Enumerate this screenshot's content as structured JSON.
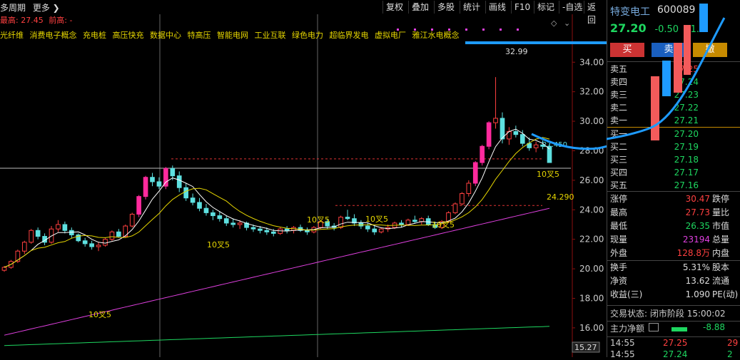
{
  "topbar": {
    "left_items": [
      "多周期",
      "更多 ❯"
    ],
    "buttons": [
      "复权",
      "叠加",
      "多股",
      "统计",
      "画线",
      "F10",
      "标记",
      "-自选",
      "返回"
    ]
  },
  "info": {
    "label1": "最高:",
    "value1": "27.45",
    "label2": "前高:",
    "value2": "-"
  },
  "concepts": [
    "光纤维",
    "消费电子概念",
    "充电桩",
    "高压快充",
    "数据中心",
    "特高压",
    "智能电网",
    "工业互联",
    "绿色电力",
    "超临界发电",
    "虚拟电厂",
    "雅江水电概念"
  ],
  "chart_data": {
    "type": "candlestick",
    "ylim": [
      15.27,
      35.8
    ],
    "yticks": [
      16.0,
      18.0,
      20.0,
      22.0,
      24.0,
      26.0,
      28.0,
      30.0,
      32.0,
      34.0
    ],
    "current_axis_label": "15.27",
    "candles": [
      [
        19.9,
        20.2,
        19.8,
        20.1
      ],
      [
        20.1,
        20.6,
        20.0,
        20.5
      ],
      [
        20.5,
        21.3,
        20.4,
        21.2
      ],
      [
        21.2,
        21.9,
        21.0,
        21.8
      ],
      [
        21.8,
        22.7,
        21.7,
        22.6
      ],
      [
        22.6,
        22.8,
        22.0,
        22.2
      ],
      [
        22.2,
        22.4,
        21.6,
        21.8
      ],
      [
        21.8,
        22.9,
        21.7,
        22.7
      ],
      [
        22.7,
        23.3,
        22.5,
        23.0
      ],
      [
        23.0,
        23.2,
        22.4,
        22.6
      ],
      [
        22.6,
        22.8,
        22.1,
        22.3
      ],
      [
        22.3,
        22.4,
        21.8,
        21.9
      ],
      [
        21.9,
        22.1,
        21.5,
        21.7
      ],
      [
        21.7,
        21.9,
        21.3,
        21.5
      ],
      [
        21.5,
        21.8,
        21.2,
        21.6
      ],
      [
        21.6,
        22.1,
        21.5,
        22.0
      ],
      [
        22.0,
        22.6,
        21.9,
        22.5
      ],
      [
        22.5,
        22.7,
        22.1,
        22.2
      ],
      [
        22.2,
        23.0,
        22.1,
        22.9
      ],
      [
        22.9,
        23.8,
        22.8,
        23.7
      ],
      [
        23.7,
        25.0,
        23.5,
        24.9
      ],
      [
        24.9,
        26.3,
        24.7,
        26.2
      ],
      [
        26.2,
        26.5,
        25.6,
        25.9
      ],
      [
        25.9,
        26.2,
        25.4,
        25.6
      ],
      [
        25.6,
        26.9,
        25.4,
        26.8
      ],
      [
        26.8,
        27.0,
        26.0,
        26.3
      ],
      [
        26.3,
        26.6,
        25.2,
        25.5
      ],
      [
        25.5,
        25.8,
        24.6,
        24.8
      ],
      [
        24.8,
        25.1,
        24.3,
        24.5
      ],
      [
        24.5,
        24.8,
        23.9,
        24.1
      ],
      [
        24.1,
        24.4,
        23.6,
        23.8
      ],
      [
        23.8,
        24.0,
        23.3,
        23.6
      ],
      [
        23.6,
        23.9,
        23.2,
        23.4
      ],
      [
        23.4,
        23.6,
        22.9,
        23.1
      ],
      [
        23.1,
        23.4,
        22.8,
        23.0
      ],
      [
        23.0,
        23.3,
        22.7,
        23.1
      ],
      [
        23.1,
        23.2,
        22.6,
        22.8
      ],
      [
        22.8,
        23.0,
        22.5,
        22.7
      ],
      [
        22.7,
        22.9,
        22.4,
        22.6
      ],
      [
        22.6,
        22.8,
        22.3,
        22.5
      ],
      [
        22.5,
        22.7,
        22.2,
        22.4
      ],
      [
        22.4,
        22.8,
        22.3,
        22.7
      ],
      [
        22.7,
        22.9,
        22.4,
        22.6
      ],
      [
        22.6,
        22.9,
        22.4,
        22.8
      ],
      [
        22.8,
        23.0,
        22.5,
        22.6
      ],
      [
        22.6,
        22.8,
        22.3,
        22.5
      ],
      [
        22.5,
        22.9,
        22.4,
        22.8
      ],
      [
        22.8,
        23.3,
        22.7,
        23.2
      ],
      [
        23.2,
        23.4,
        22.7,
        22.9
      ],
      [
        22.9,
        23.1,
        22.6,
        22.8
      ],
      [
        22.8,
        23.6,
        22.7,
        23.5
      ],
      [
        23.5,
        24.0,
        23.3,
        23.4
      ],
      [
        23.4,
        23.7,
        22.9,
        23.1
      ],
      [
        23.1,
        23.3,
        22.7,
        22.9
      ],
      [
        22.9,
        23.1,
        22.5,
        22.7
      ],
      [
        22.7,
        22.9,
        22.3,
        22.5
      ],
      [
        22.5,
        22.8,
        22.4,
        22.7
      ],
      [
        22.7,
        23.0,
        22.5,
        22.8
      ],
      [
        22.8,
        23.2,
        22.7,
        23.1
      ],
      [
        23.1,
        23.3,
        22.8,
        23.0
      ],
      [
        23.0,
        23.4,
        22.9,
        23.3
      ],
      [
        23.3,
        23.6,
        23.1,
        23.2
      ],
      [
        23.2,
        23.5,
        23.0,
        23.4
      ],
      [
        23.4,
        23.6,
        22.9,
        23.0
      ],
      [
        23.0,
        23.2,
        22.7,
        22.8
      ],
      [
        22.8,
        23.3,
        22.7,
        23.2
      ],
      [
        23.2,
        23.9,
        23.1,
        23.8
      ],
      [
        23.8,
        24.5,
        23.7,
        24.4
      ],
      [
        24.4,
        25.2,
        24.3,
        25.1
      ],
      [
        25.1,
        26.0,
        24.9,
        25.8
      ],
      [
        25.8,
        27.3,
        25.6,
        27.2
      ],
      [
        27.2,
        28.4,
        27.0,
        28.3
      ],
      [
        28.3,
        30.0,
        28.1,
        29.9
      ],
      [
        29.9,
        32.99,
        29.5,
        30.2
      ],
      [
        30.2,
        30.6,
        28.5,
        28.8
      ],
      [
        28.8,
        29.6,
        28.4,
        29.3
      ],
      [
        29.3,
        29.7,
        28.9,
        29.1
      ],
      [
        29.1,
        29.4,
        28.3,
        28.5
      ],
      [
        28.5,
        28.9,
        28.0,
        28.2
      ],
      [
        28.2,
        28.6,
        27.9,
        28.4
      ],
      [
        28.4,
        28.7,
        28.1,
        28.3
      ],
      [
        28.3,
        28.5,
        27.2,
        27.2
      ]
    ],
    "ma_labels": [
      "10叉5",
      "10叉5",
      "10叉5",
      "10叉5",
      "10叉5",
      "10叉5"
    ],
    "price_labels": [
      "32.99",
      "24.290",
      "27.450"
    ]
  },
  "quote": {
    "name": "特变电工",
    "code": "600089",
    "price": "27.20",
    "change": "-0.50",
    "pct": "-1.8",
    "buy": "买",
    "sell": "卖",
    "cancel": "撤"
  },
  "orderbook": [
    {
      "label": "卖五",
      "price": "27.25"
    },
    {
      "label": "卖四",
      "price": "27.24"
    },
    {
      "label": "卖三",
      "price": "27.23"
    },
    {
      "label": "卖二",
      "price": "27.22"
    },
    {
      "label": "卖一",
      "price": "27.21"
    },
    {
      "label": "买一",
      "price": "27.20"
    },
    {
      "label": "买二",
      "price": "27.19"
    },
    {
      "label": "买三",
      "price": "27.18"
    },
    {
      "label": "买四",
      "price": "27.17"
    },
    {
      "label": "买五",
      "price": "27.16"
    }
  ],
  "stats": [
    {
      "label": "涨停",
      "value": "30.47",
      "label2": "跌停",
      "color": "#ff4040"
    },
    {
      "label": "最高",
      "value": "27.73",
      "label2": "量比",
      "color": "#ff4040"
    },
    {
      "label": "最低",
      "value": "26.35",
      "label2": "市值",
      "color": "#1ed760"
    },
    {
      "label": "现量",
      "value": "23194",
      "label2": "总量",
      "color": "#e040e0"
    },
    {
      "label": "外盘",
      "value": "128.8万",
      "label2": "内盘",
      "color": "#ff4040"
    },
    {
      "label": "换手",
      "value": "5.31%",
      "label2": "股本",
      "color": "#ddd"
    },
    {
      "label": "净资",
      "value": "13.62",
      "label2": "流通",
      "color": "#ddd"
    },
    {
      "label": "收益(三)",
      "value": "1.090",
      "label2": "PE(动)",
      "color": "#ddd"
    }
  ],
  "status": {
    "label": "交易状态:",
    "value": "闭市阶段",
    "time": "15:00:02"
  },
  "fund": {
    "label": "主力净额",
    "value": "-8.88"
  },
  "ticks": [
    {
      "time": "14:55",
      "price": "27.25",
      "vol": "29"
    },
    {
      "time": "14:55",
      "price": "27.24",
      "vol": "2"
    }
  ]
}
